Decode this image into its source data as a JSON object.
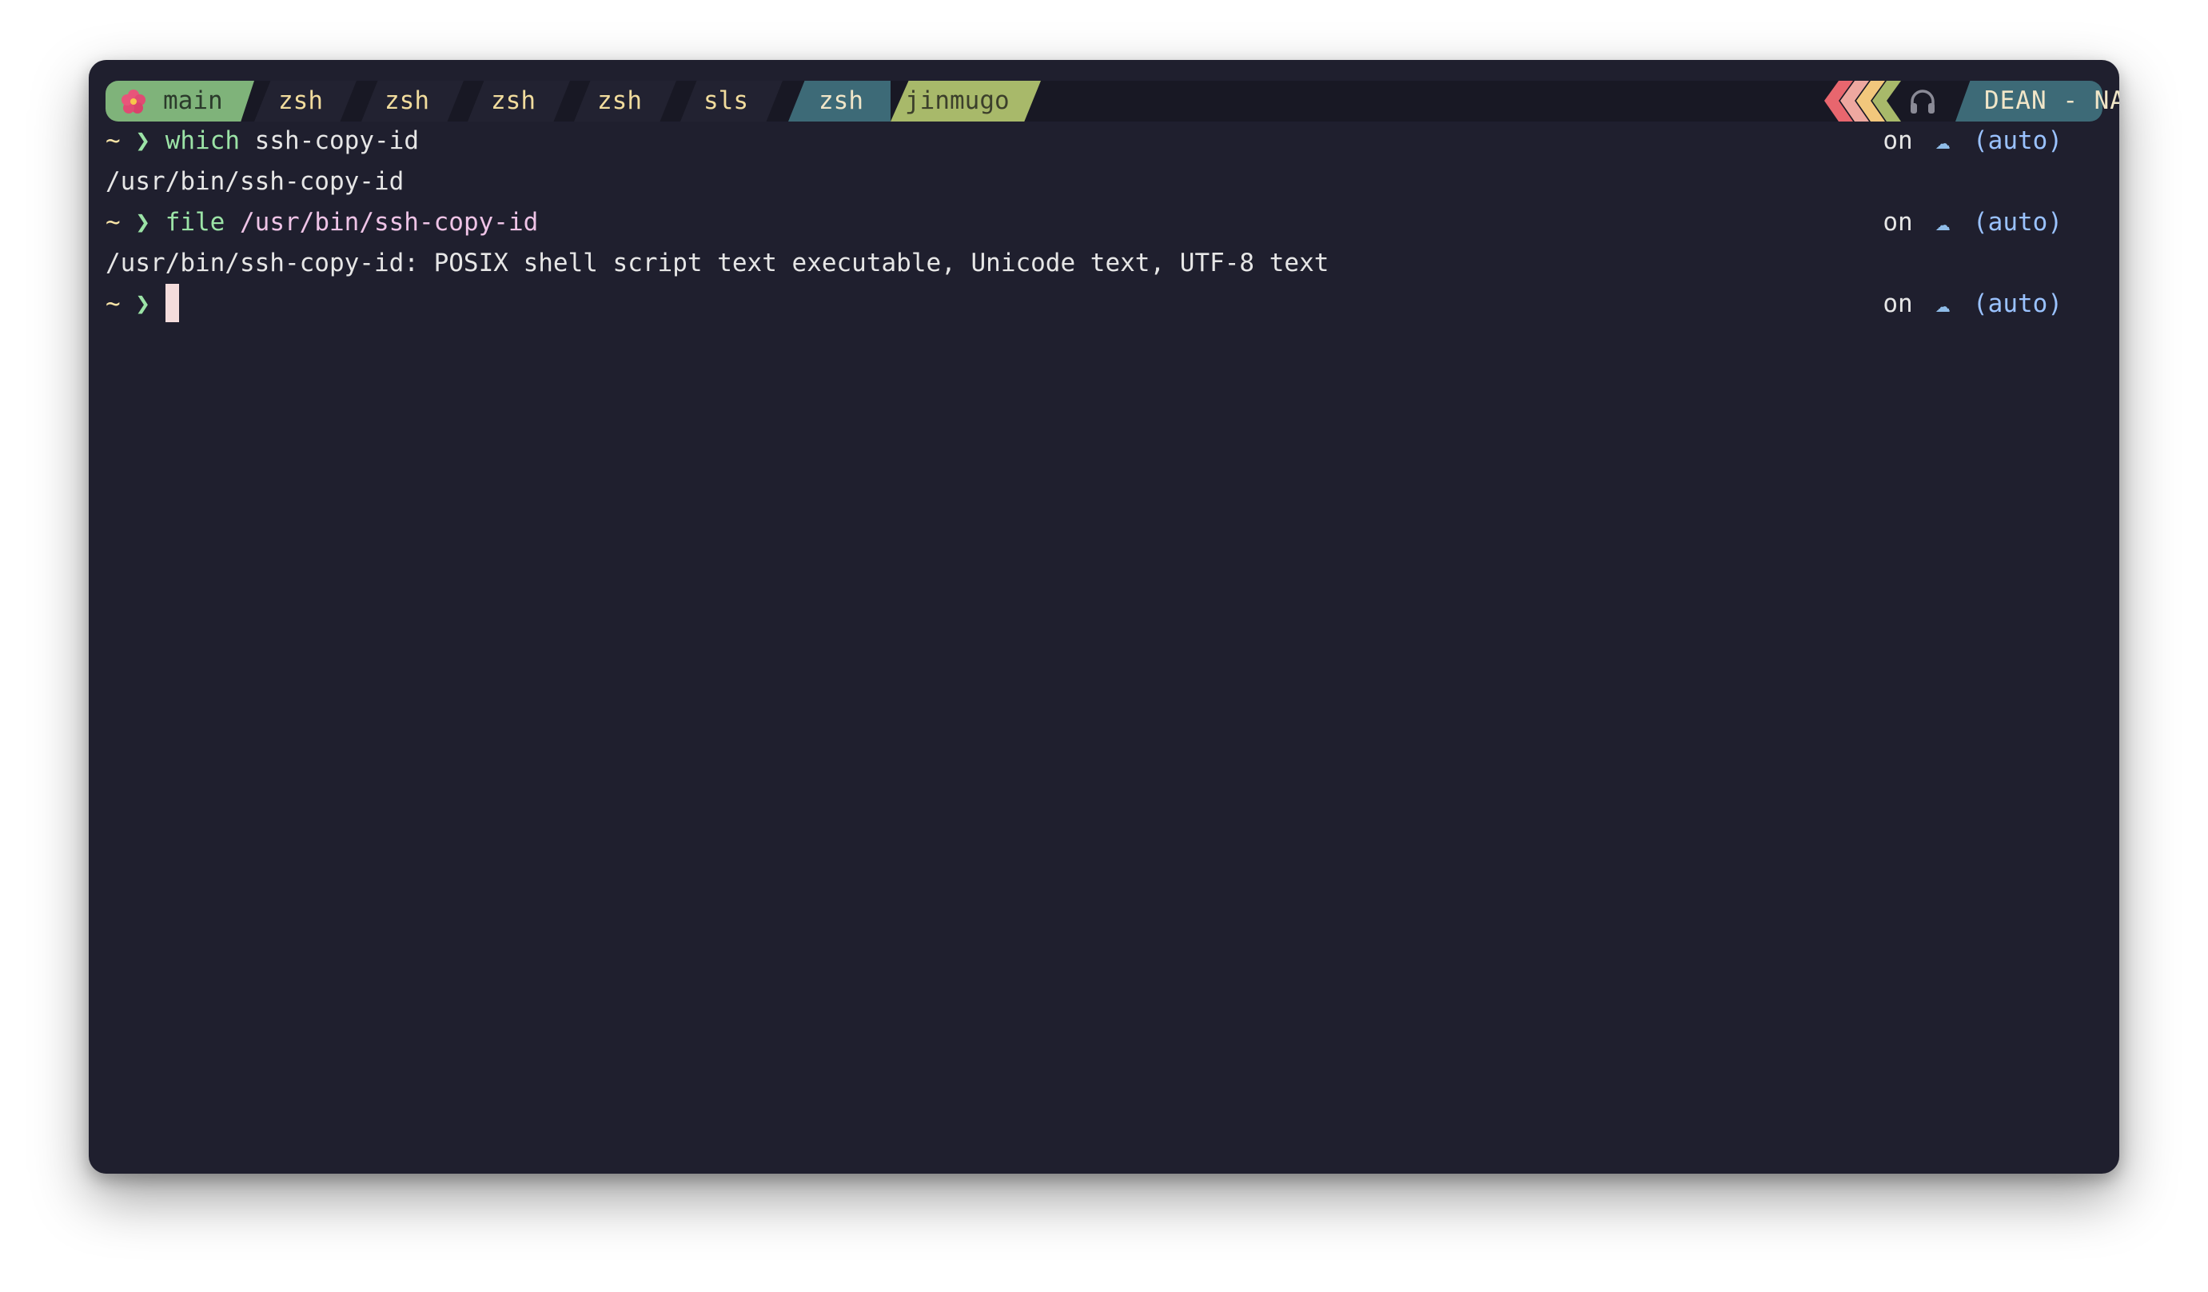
{
  "status_bar": {
    "tabs": [
      {
        "label": "main",
        "icon": "hibiscus-icon"
      },
      {
        "label": "zsh"
      },
      {
        "label": "zsh"
      },
      {
        "label": "zsh"
      },
      {
        "label": "zsh"
      },
      {
        "label": "sls"
      },
      {
        "label": "zsh",
        "active": true
      },
      {
        "label": "jinmugo"
      }
    ],
    "right_icons": [
      "chevrons-left-icon",
      "headphones-icon"
    ],
    "session_label": "DEAN - NASA"
  },
  "terminal": {
    "prompt_symbol": "~",
    "prompt_arrow": "❯",
    "lines": [
      {
        "type": "command",
        "cmd": "which",
        "args": " ssh-copy-id",
        "rprompt": {
          "on": "on",
          "icon": "cloud-icon",
          "context": "(auto)"
        }
      },
      {
        "type": "output",
        "text": "/usr/bin/ssh-copy-id"
      },
      {
        "type": "command",
        "cmd": "file",
        "args": " /usr/bin/ssh-copy-id",
        "rprompt": {
          "on": "on",
          "icon": "cloud-icon",
          "context": "(auto)"
        }
      },
      {
        "type": "output",
        "text": "/usr/bin/ssh-copy-id: POSIX shell script text executable, Unicode text, UTF-8 text"
      },
      {
        "type": "prompt",
        "rprompt": {
          "on": "on",
          "icon": "cloud-icon",
          "context": "(auto)"
        }
      }
    ]
  },
  "colors": {
    "background": "#1f1f2e",
    "tab_main": "#7fb37a",
    "tab_active": "#3d6a77",
    "tab_branch": "#a8b96a",
    "prompt_green": "#9be3a6",
    "arg_pink": "#eec3e6",
    "context_blue": "#9ac2ff"
  }
}
